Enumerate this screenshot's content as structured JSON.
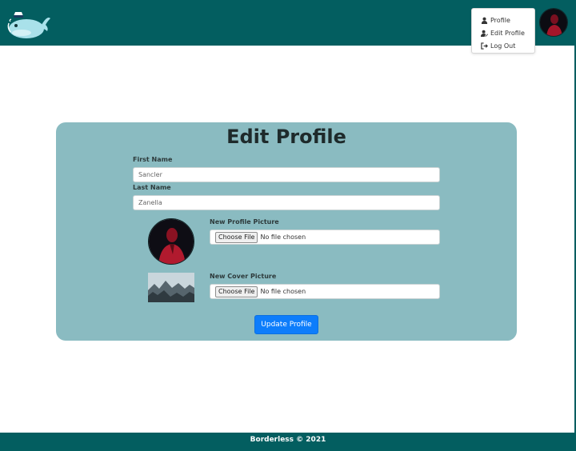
{
  "nav": {
    "menu": [
      {
        "label": "Profile",
        "icon": "user-icon"
      },
      {
        "label": "Edit Profile",
        "icon": "user-edit-icon"
      },
      {
        "label": "Log Out",
        "icon": "sign-out-icon"
      }
    ]
  },
  "form": {
    "title": "Edit Profile",
    "first_name_label": "First Name",
    "first_name_value": "Sancler",
    "last_name_label": "Last Name",
    "last_name_value": "Zanella",
    "profile_picture_label": "New Profile Picture",
    "cover_picture_label": "New Cover Picture",
    "choose_file_label": "Choose File",
    "no_file_text": "No file chosen",
    "submit_label": "Update Profile"
  },
  "footer": {
    "text": "Borderless © 2021"
  },
  "colors": {
    "brand": "#035e60",
    "card": "#8abbc1",
    "primary_button": "#0d7dfb"
  }
}
